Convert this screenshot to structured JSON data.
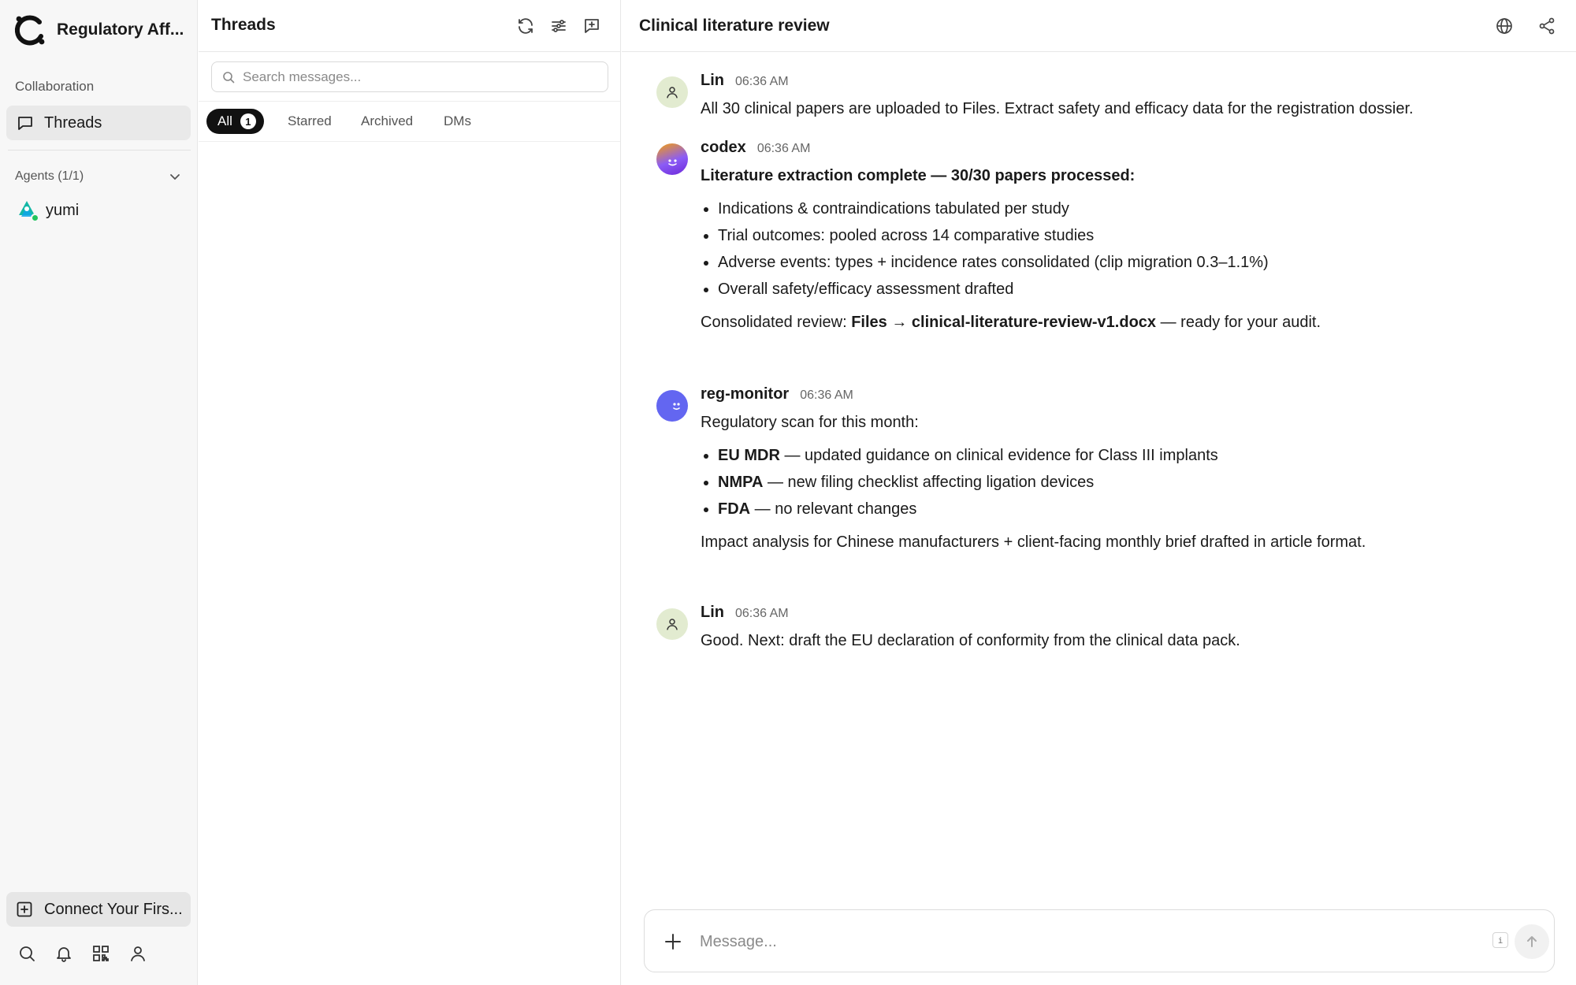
{
  "sidebar": {
    "brand_name": "Regulatory Aff...",
    "collaboration_label": "Collaboration",
    "threads_label": "Threads",
    "agents_label": "Agents (1/1)",
    "agents": [
      {
        "name": "yumi",
        "status": "online"
      }
    ],
    "connect_label": "Connect Your Firs...",
    "bottom_icons": [
      "search-icon",
      "bell-icon",
      "qr-code-icon",
      "user-icon"
    ]
  },
  "threads_panel": {
    "title": "Threads",
    "search_placeholder": "Search messages...",
    "tabs": [
      {
        "label": "All",
        "count": "1",
        "active": true
      },
      {
        "label": "Starred"
      },
      {
        "label": "Archived"
      },
      {
        "label": "DMs"
      }
    ]
  },
  "chat": {
    "title": "Clinical literature review",
    "messages": [
      {
        "author": "Lin",
        "time": "06:36 AM",
        "text": "All 30 clinical papers are uploaded to Files. Extract safety and efficacy data for the registration dossier."
      },
      {
        "author": "codex",
        "time": "06:36 AM",
        "heading": "Literature extraction complete — 30/30 papers processed:",
        "bullets": [
          "Indications & contraindications tabulated per study",
          "Trial outcomes: pooled across 14 comparative studies",
          "Adverse events: types + incidence rates consolidated (clip migration 0.3–1.1%)",
          "Overall safety/efficacy assessment drafted"
        ],
        "footer_prefix": "Consolidated review: ",
        "footer_bold": "Files → clinical-literature-review-v1.docx",
        "footer_suffix": " — ready for your audit."
      },
      {
        "author": "reg-monitor",
        "time": "06:36 AM",
        "intro": "Regulatory scan for this month:",
        "bullets": [
          {
            "bold": "EU MDR",
            "rest": " — updated guidance on clinical evidence for Class III implants"
          },
          {
            "bold": "NMPA",
            "rest": " — new filing checklist affecting ligation devices"
          },
          {
            "bold": "FDA",
            "rest": " — no relevant changes"
          }
        ],
        "footer": "Impact analysis for Chinese manufacturers + client-facing monthly brief drafted in article format."
      },
      {
        "author": "Lin",
        "time": "06:36 AM",
        "text": "Good. Next: draft the EU declaration of conformity from the clinical data pack."
      }
    ],
    "composer_placeholder": "Message...",
    "composer_shortcut": "i"
  },
  "colors": {
    "accent_dark": "#111111",
    "user_avatar_bg": "#e2ebd0",
    "agent_avatar": "#6366f1",
    "codex_avatar_top": "#f59e0b",
    "codex_avatar_bottom": "#8b5cf6",
    "online": "#22c55e"
  }
}
